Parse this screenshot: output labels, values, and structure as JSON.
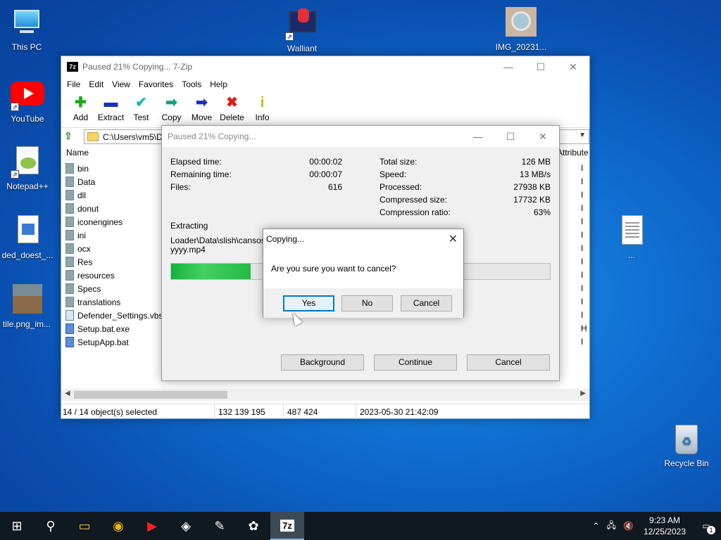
{
  "desktop": {
    "icons": [
      {
        "label": "This PC",
        "icon": "monitor-icon"
      },
      {
        "label": "YouTube",
        "icon": "youtube-icon"
      },
      {
        "label": "Notepad++",
        "icon": "notepadpp-icon"
      },
      {
        "label": "ded_doest_...",
        "icon": "image-file-icon"
      },
      {
        "label": "tile.png_im...",
        "icon": "image-thumbnail-icon"
      },
      {
        "label": "Walliant",
        "icon": "walliant-icon"
      },
      {
        "label": "IMG_20231...",
        "icon": "photo-thumbnail-icon"
      },
      {
        "label": "...",
        "icon": "document-icon"
      },
      {
        "label": "Recycle Bin",
        "icon": "recycle-bin-icon"
      }
    ]
  },
  "zip_window": {
    "title": "Paused 21% Copying... 7-Zip",
    "menu": [
      "File",
      "Edit",
      "View",
      "Favorites",
      "Tools",
      "Help"
    ],
    "toolbar": [
      {
        "label": "Add",
        "icon": "plus-icon",
        "glyph": "✚",
        "color": "#1fa81f"
      },
      {
        "label": "Extract",
        "icon": "minus-icon",
        "glyph": "▬",
        "color": "#1a2fb8"
      },
      {
        "label": "Test",
        "icon": "checkmark-icon",
        "glyph": "✔",
        "color": "#1fb7b7"
      },
      {
        "label": "Copy",
        "icon": "copy-arrow-icon",
        "glyph": "➡",
        "color": "#16a085"
      },
      {
        "label": "Move",
        "icon": "move-arrow-icon",
        "glyph": "➡",
        "color": "#1a2fb8"
      },
      {
        "label": "Delete",
        "icon": "delete-x-icon",
        "glyph": "✖",
        "color": "#e01b1b"
      },
      {
        "label": "Info",
        "icon": "info-icon",
        "glyph": "i",
        "color": "#d4b000"
      }
    ],
    "address": "C:\\Users\\vm5\\De",
    "columns": {
      "name": "Name",
      "attributes": "Attribute"
    },
    "files": [
      {
        "name": "bin",
        "type": "folder",
        "attr": "I"
      },
      {
        "name": "Data",
        "type": "folder",
        "attr": "I"
      },
      {
        "name": "dll",
        "type": "folder",
        "attr": "I"
      },
      {
        "name": "donut",
        "type": "folder",
        "attr": "I"
      },
      {
        "name": "iconengines",
        "type": "folder",
        "attr": "I"
      },
      {
        "name": "ini",
        "type": "folder",
        "attr": "I"
      },
      {
        "name": "ocx",
        "type": "folder",
        "attr": "I"
      },
      {
        "name": "Res",
        "type": "folder",
        "attr": "I"
      },
      {
        "name": "resources",
        "type": "folder",
        "attr": "I"
      },
      {
        "name": "Specs",
        "type": "folder",
        "attr": "I"
      },
      {
        "name": "translations",
        "type": "folder",
        "attr": "I"
      },
      {
        "name": "Defender_Settings.vbs",
        "type": "vbs",
        "attr": "I"
      },
      {
        "name": "Setup.bat.exe",
        "type": "exe",
        "attr": "H"
      },
      {
        "name": "SetupApp.bat",
        "type": "bat",
        "attr": "I"
      }
    ],
    "status": {
      "selected": "14 / 14 object(s) selected",
      "size": "132 139 195",
      "packed": "487 424",
      "date": "2023-05-30 21:42:09"
    }
  },
  "progress_window": {
    "title": "Paused 21% Copying...",
    "left_stats": [
      {
        "label": "Elapsed time:",
        "value": "00:00:02"
      },
      {
        "label": "Remaining time:",
        "value": "00:00:07"
      },
      {
        "label": "Files:",
        "value": "616"
      }
    ],
    "right_stats": [
      {
        "label": "Total size:",
        "value": "126 MB"
      },
      {
        "label": "Speed:",
        "value": "13 MB/s"
      },
      {
        "label": "Processed:",
        "value": "27938 KB"
      },
      {
        "label": "Compressed size:",
        "value": "17732 KB"
      },
      {
        "label": "Compression ratio:",
        "value": "63%"
      }
    ],
    "operation": "Extracting",
    "path_line1": "Loader\\Data\\slish\\cansosA",
    "path_line2": "yyyy.mp4",
    "progress_fraction": 0.21,
    "buttons": {
      "background": "Background",
      "continue": "Continue",
      "cancel": "Cancel"
    }
  },
  "confirm_dialog": {
    "title": "Copying...",
    "message": "Are you sure you want to cancel?",
    "buttons": {
      "yes": "Yes",
      "no": "No",
      "cancel": "Cancel"
    }
  },
  "taskbar": {
    "items": [
      {
        "name": "start-icon",
        "glyph": "⊞"
      },
      {
        "name": "search-icon",
        "glyph": "⚲"
      },
      {
        "name": "file-explorer-icon",
        "glyph": "▭"
      },
      {
        "name": "chrome-icon",
        "glyph": "◉"
      },
      {
        "name": "youtube-icon",
        "glyph": "▶"
      },
      {
        "name": "app-icon",
        "glyph": "◈"
      },
      {
        "name": "notepadpp-icon",
        "glyph": "✎"
      },
      {
        "name": "paint-icon",
        "glyph": "✿"
      },
      {
        "name": "7zip-icon",
        "glyph": "7z"
      }
    ],
    "time": "9:23 AM",
    "date": "12/25/2023",
    "notification_count": "1"
  }
}
